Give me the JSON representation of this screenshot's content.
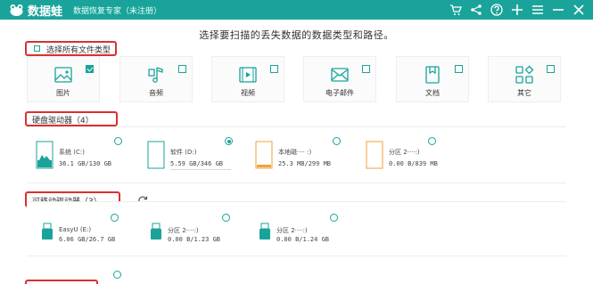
{
  "app": {
    "name": "数据蛙",
    "subtitle": "数据恢复专家（未注册）"
  },
  "titlebar_icons": [
    "cart-icon",
    "share-icon",
    "help-icon",
    "plus-icon",
    "menu-icon",
    "minimize-icon",
    "close-icon"
  ],
  "colors": {
    "brand": "#1aa39a",
    "highlight": "#d8322f",
    "disk_orange": "#f0a23a"
  },
  "instruction": "选择要扫描的丢失数据的数据类型和路径。",
  "file_types": {
    "select_all_label": "选择所有文件类型",
    "select_all_checked": false,
    "items": [
      {
        "label": "图片",
        "icon": "image-icon",
        "checked": true
      },
      {
        "label": "音频",
        "icon": "audio-icon",
        "checked": false
      },
      {
        "label": "视频",
        "icon": "video-icon",
        "checked": false
      },
      {
        "label": "电子邮件",
        "icon": "email-icon",
        "checked": false
      },
      {
        "label": "文档",
        "icon": "document-icon",
        "checked": false
      },
      {
        "label": "其它",
        "icon": "other-icon",
        "checked": false
      }
    ]
  },
  "hard_drives": {
    "title": "硬盘驱动器（4）",
    "items": [
      {
        "name": "系统 (C:)",
        "size": "36.1 GB/130 GB",
        "selected": false,
        "fill": 0.28
      },
      {
        "name": "软件 (D:)",
        "size": "5.59 GB/346 GB",
        "selected": true,
        "fill": 0.02
      },
      {
        "name": "本地磁···· :)",
        "size": "25.3 MB/299 MB",
        "selected": false,
        "fill": 0.08
      },
      {
        "name": "分区 2····:)",
        "size": "0.00  B/839 MB",
        "selected": false,
        "fill": 0
      }
    ]
  },
  "removable_drives": {
    "title": "可移动驱动器（3）",
    "items": [
      {
        "name": "EasyU (E:)",
        "size": "6.06 GB/26.7 GB",
        "selected": false
      },
      {
        "name": "分区 2····:)",
        "size": "0.00  B/1.23 GB",
        "selected": false
      },
      {
        "name": "分区 2····:)",
        "size": "0.00  B/1.24 GB",
        "selected": false
      }
    ]
  }
}
